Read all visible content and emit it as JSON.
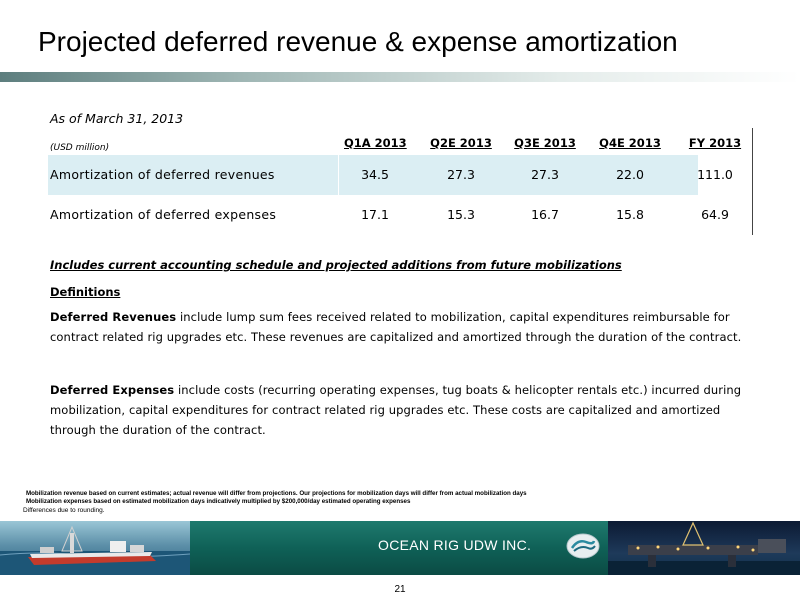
{
  "title": "Projected deferred revenue & expense amortization",
  "as_of": "As of March 31, 2013",
  "units": "(USD million)",
  "table": {
    "columns": [
      "Q1A 2013",
      "Q2E 2013",
      "Q3E 2013",
      "Q4E 2013",
      "FY 2013"
    ],
    "rows": [
      {
        "label": "Amortization of deferred revenues",
        "values": [
          "34.5",
          "27.3",
          "27.3",
          "22.0",
          "111.0"
        ]
      },
      {
        "label": "Amortization of deferred expenses",
        "values": [
          "17.1",
          "15.3",
          "16.7",
          "15.8",
          "64.9"
        ]
      }
    ]
  },
  "includes_note": "Includes current accounting schedule and projected additions from future mobilizations",
  "definitions_heading": "Definitions",
  "deferred_revenues": {
    "term": "Deferred Revenues",
    "text": " include lump sum fees received related to mobilization, capital expenditures reimbursable for contract related rig upgrades etc.  These revenues are capitalized and amortized through the duration of the contract."
  },
  "deferred_expenses": {
    "term": "Deferred Expenses",
    "text": " include costs (recurring operating expenses, tug boats & helicopter rentals etc.)  incurred during mobilization, capital expenditures for contract related rig upgrades etc.  These costs are capitalized and amortized through the duration of the contract."
  },
  "footnotes": [
    "Mobilization revenue based on current estimates; actual revenue will differ from projections. Our projections for mobilization days will differ from actual mobilization days",
    "Mobilization expenses based on estimated  mobilization days indicatively  multiplied by $200,000/day estimated operating expenses"
  ],
  "rounding_note": "Differences due to rounding.",
  "footer": {
    "company": "OCEAN RIG UDW INC.",
    "logo_icon": "ocean-rig-logo-icon",
    "left_image_icon": "drillship-image-icon",
    "right_image_icon": "drilling-rig-night-image-icon"
  },
  "page_number": "21",
  "colors": {
    "shaded_row": "#dbeef3",
    "footer_green": "#0f6157"
  }
}
